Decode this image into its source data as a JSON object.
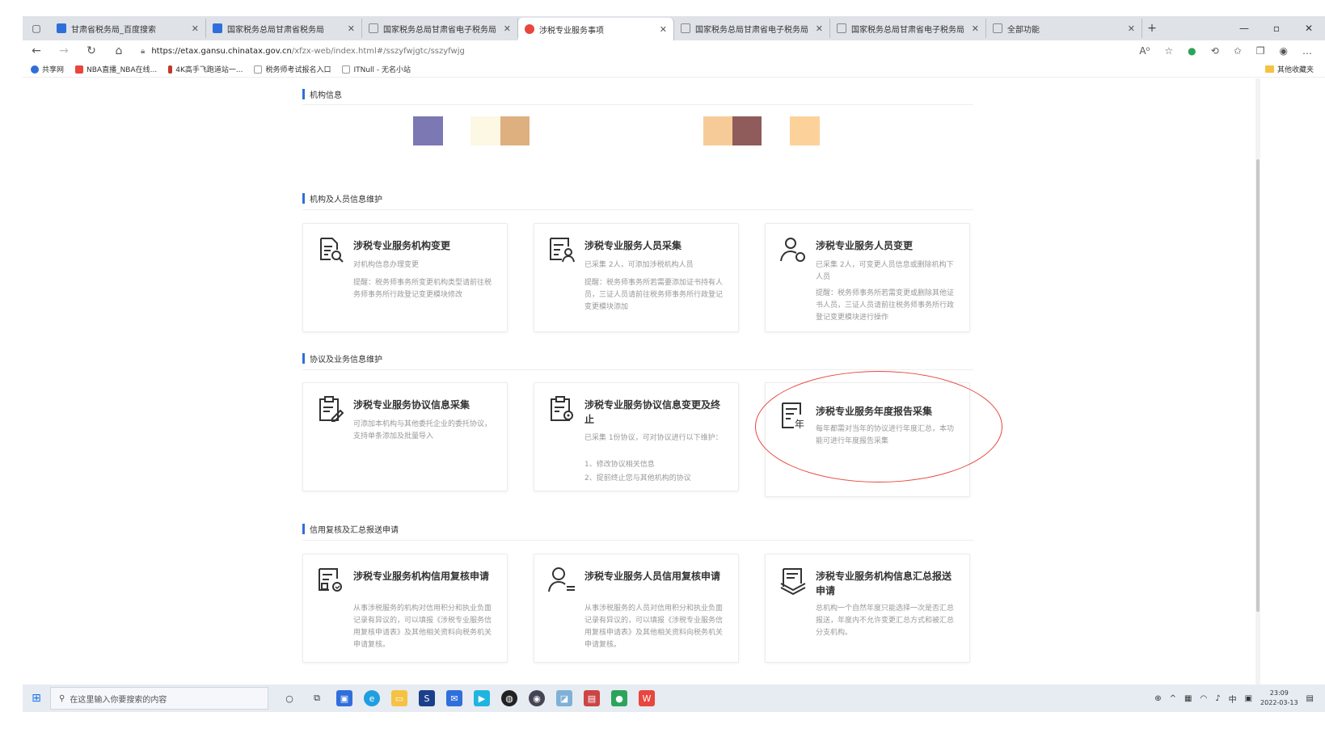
{
  "browser": {
    "tabs": [
      {
        "title": "甘肃省税务局_百度搜索",
        "color": "#2f6fdb"
      },
      {
        "title": "国家税务总局甘肃省税务局",
        "color": "#2f6fdb"
      },
      {
        "title": "国家税务总局甘肃省电子税务局",
        "color": "#888888"
      },
      {
        "title": "涉税专业服务事项",
        "color": "#e8463e"
      },
      {
        "title": "国家税务总局甘肃省电子税务局",
        "color": "#888888"
      },
      {
        "title": "国家税务总局甘肃省电子税务局",
        "color": "#888888"
      },
      {
        "title": "全部功能",
        "color": "#888888"
      }
    ],
    "url_host": "https://etax.gansu.chinatax.gov.cn",
    "url_path": "/xfzx-web/index.html#/sszyfwjgtc/sszyfwjg",
    "bookmarks": [
      {
        "label": "共享网",
        "color": "#2f6fdb"
      },
      {
        "label": "NBA直播_NBA在线...",
        "color": "#e8463e"
      },
      {
        "label": "4K高手飞跑道站一...",
        "color": "#c0392b"
      },
      {
        "label": "税务师考试报名入口",
        "color": "#999999"
      },
      {
        "label": "ITNull - 无名小站",
        "color": "#999999"
      }
    ],
    "other_bookmarks": "其他收藏夹"
  },
  "sections": {
    "org_info": "机构信息",
    "org_staff": "机构及人员信息维护",
    "agreement": "协议及业务信息维护",
    "credit": "信用复核及汇总报送申请"
  },
  "swatches": [
    {
      "color": "#7b78b4"
    },
    {
      "color": "#fdf8e4"
    },
    {
      "color": "#deb080"
    },
    {
      "color": "#f7cb97"
    },
    {
      "color": "#8f5b5b"
    },
    {
      "color": "#fdd29a"
    }
  ],
  "cards": {
    "c1": {
      "title": "涉税专业服务机构变更",
      "desc1": "对机构信息办理变更",
      "desc2": "提醒：税务师事务所变更机构类型请前往税务师事务所行政登记变更模块修改"
    },
    "c2": {
      "title": "涉税专业服务人员采集",
      "desc1": "已采集 2人，可添加涉税机构人员",
      "desc2": "提醒：税务师事务所若需要添加证书持有人员，三证人员请前往税务师事务所行政登记变更模块添加"
    },
    "c3": {
      "title": "涉税专业服务人员变更",
      "desc1": "已采集 2人，可变更人员信息或删除机构下人员",
      "desc2": "提醒：税务师事务所若需变更或删除其他证书人员，三证人员请前往税务师事务所行政登记变更模块进行操作"
    },
    "c4": {
      "title": "涉税专业服务协议信息采集",
      "desc1": "可添加本机构与其他委托企业的委托协议，支持单条添加及批量导入",
      "desc2": ""
    },
    "c5": {
      "title": "涉税专业服务协议信息变更及终止",
      "desc1": "已采集 1份协议，可对协议进行以下维护：",
      "desc2": "1、修改协议相关信息",
      "desc3": "2、提前终止您与其他机构的协议"
    },
    "c6": {
      "title": "涉税专业服务年度报告采集",
      "desc1": "每年都需对当年的协议进行年度汇总，本功能可进行年度报告采集",
      "desc2": ""
    },
    "c7": {
      "title": "涉税专业服务机构信用复核申请",
      "desc1": "从事涉税服务的机构对信用积分和执业负面记录有异议的，可以填报《涉税专业服务信用复核申请表》及其他相关资料向税务机关申请复核。",
      "desc2": ""
    },
    "c8": {
      "title": "涉税专业服务人员信用复核申请",
      "desc1": "从事涉税服务的人员对信用积分和执业负面记录有异议的，可以填报《涉税专业服务信用复核申请表》及其他相关资料向税务机关申请复核。",
      "desc2": ""
    },
    "c9": {
      "title": "涉税专业服务机构信息汇总报送申请",
      "desc1": "总机构一个自然年度只能选择一次是否汇总报送，年度内不允许变更汇总方式和被汇总分支机构。",
      "desc2": ""
    }
  },
  "taskbar": {
    "search_placeholder": "在这里输入你要搜索的内容",
    "time": "23:09",
    "date": "2022-03-13",
    "ime": "中"
  }
}
